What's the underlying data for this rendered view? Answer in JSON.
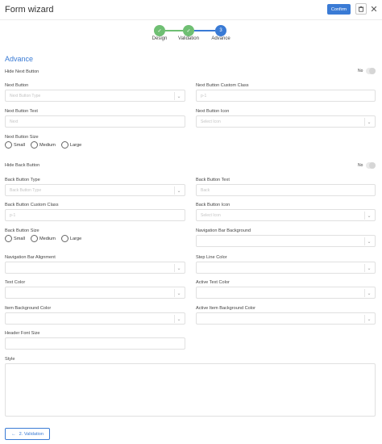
{
  "header": {
    "title": "Form wizard",
    "confirm_label": "Confirm"
  },
  "steps": [
    {
      "label": "Design",
      "state": "done"
    },
    {
      "label": "Validation",
      "state": "done"
    },
    {
      "label": "Advance",
      "state": "active",
      "number": "3"
    }
  ],
  "section": {
    "title": "Advance"
  },
  "next": {
    "hide_label": "Hide Next Button",
    "hide_value": "No",
    "button_label": "Next Button",
    "button_placeholder": "Next Button Type",
    "custom_class_label": "Next Button Custom Class",
    "custom_class_placeholder": "p-1",
    "text_label": "Next Button Text",
    "text_placeholder": "Next",
    "icon_label": "Next Button Icon",
    "icon_placeholder": "Select Icon",
    "size_label": "Next Button Size",
    "sizes": [
      "Small",
      "Medium",
      "Large"
    ]
  },
  "back": {
    "hide_label": "Hide Back Button",
    "hide_value": "No",
    "type_label": "Back Button Type",
    "type_placeholder": "Back Button Type",
    "text_label": "Back Button Text",
    "text_placeholder": "Back",
    "custom_class_label": "Back Button Custom Class",
    "custom_class_placeholder": "p-1",
    "icon_label": "Back Button Icon",
    "icon_placeholder": "Select Icon",
    "size_label": "Back Button Size",
    "sizes": [
      "Small",
      "Medium",
      "Large"
    ]
  },
  "nav": {
    "background_label": "Navigation Bar Background",
    "alignment_label": "Navigation Bar Alignment",
    "step_line_color_label": "Step Line Color",
    "text_color_label": "Text Color",
    "active_text_color_label": "Active Text Color",
    "item_bg_label": "Item Background Color",
    "active_item_bg_label": "Active Item Background Color",
    "header_font_size_label": "Header Font Size",
    "style_label": "Style"
  },
  "footer": {
    "back_label": "2. Validation"
  },
  "colors": {
    "accent": "#3a7bd5",
    "done": "#6fbf73"
  }
}
